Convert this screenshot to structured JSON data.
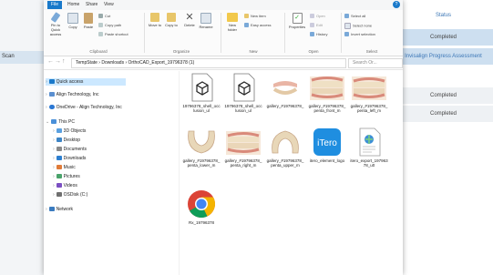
{
  "background_app": {
    "left_row_label": "Scan",
    "status_header": "Status",
    "cells": [
      "Completed",
      "Invisalign Progress Assessment",
      "Completed",
      "Completed"
    ]
  },
  "explorer": {
    "tabs": [
      "File",
      "Home",
      "Share",
      "View"
    ],
    "ribbon": {
      "pin_label": "Pin to Quick access",
      "copy_label": "Copy",
      "paste_label": "Paste",
      "cut_label": "Cut",
      "copy_path_label": "Copy path",
      "paste_shortcut_label": "Paste shortcut",
      "move_to_label": "Move to",
      "copy_to_label": "Copy to",
      "delete_label": "Delete",
      "rename_label": "Rename",
      "new_folder_label": "New folder",
      "new_item_label": "New item",
      "easy_access_label": "Easy access",
      "properties_label": "Properties",
      "open_label": "Open",
      "edit_label": "Edit",
      "history_label": "History",
      "select_all_label": "Select all",
      "select_none_label": "Select none",
      "invert_selection_label": "Invert selection",
      "groups": [
        "Clipboard",
        "Organize",
        "New",
        "Open",
        "Select"
      ]
    },
    "address": {
      "path": "TempState › Downloads › OrthoCAD_Export_19796378 (1)",
      "search_placeholder": "Search Or..."
    },
    "nav_items": [
      {
        "label": "Quick access",
        "color": "#1979ca"
      },
      {
        "label": "Align Technology, Inc",
        "color": "#5a8fd0"
      },
      {
        "label": "OneDrive - Align Technology, Inc",
        "color": "#2b78d4"
      },
      {
        "label": "This PC",
        "color": "#4a90d9"
      },
      {
        "label": "3D Objects",
        "color": "#5aa0e0"
      },
      {
        "label": "Desktop",
        "color": "#3d85c6"
      },
      {
        "label": "Documents",
        "color": "#8a8a8a"
      },
      {
        "label": "Downloads",
        "color": "#2d7fd0"
      },
      {
        "label": "Music",
        "color": "#e07b39"
      },
      {
        "label": "Pictures",
        "color": "#4aa36b"
      },
      {
        "label": "Videos",
        "color": "#7b4fc2"
      },
      {
        "label": "OSDisk (C:)",
        "color": "#6f6f6f"
      },
      {
        "label": "Network",
        "color": "#3a7bbf"
      }
    ],
    "files": [
      {
        "name": "19796378_shell_occlusion_ul",
        "icon": "3d-model-icon"
      },
      {
        "name": "19796378_shell_occlusion_ul",
        "icon": "3d-model-icon"
      },
      {
        "name": "gallery_#19796378_",
        "icon": "teeth-image-icon"
      },
      {
        "name": "gallery_#19796378_penta_front_m",
        "icon": "teeth-image-icon"
      },
      {
        "name": "gallery_#19796378_penta_left_m",
        "icon": "teeth-image-icon"
      },
      {
        "name": "gallery_#19796378_penta_lower_m",
        "icon": "teeth-image-icon"
      },
      {
        "name": "gallery_#19796378_penta_right_m",
        "icon": "teeth-image-icon"
      },
      {
        "name": "gallery_#19796378_penta_upper_m",
        "icon": "teeth-image-icon"
      },
      {
        "name": "itero_element_logo",
        "icon": "itero-logo-icon"
      },
      {
        "name": "itero_export_19796378_u0",
        "icon": "html-file-icon"
      },
      {
        "name": "Rx_19796378",
        "icon": "chrome-icon"
      }
    ]
  }
}
